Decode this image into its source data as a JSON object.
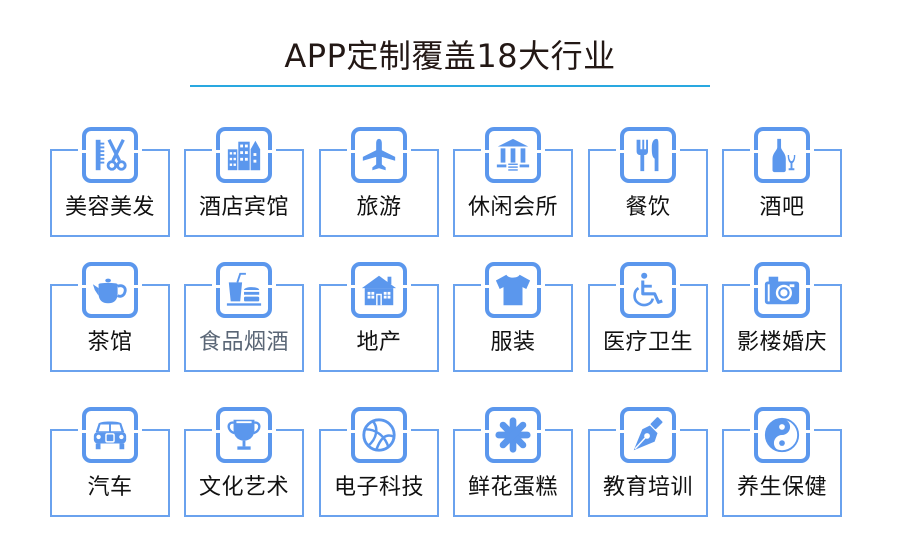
{
  "header": {
    "title": "APP定制覆盖18大行业"
  },
  "colors": {
    "accent": "#5b97ed",
    "frame": "#6aa2ee",
    "rule": "#29a8e0",
    "text": "#111111"
  },
  "industries": [
    {
      "label": "美容美发",
      "icon": "scissors-comb-icon"
    },
    {
      "label": "酒店宾馆",
      "icon": "buildings-icon"
    },
    {
      "label": "旅游",
      "icon": "airplane-icon"
    },
    {
      "label": "休闲会所",
      "icon": "columns-building-icon"
    },
    {
      "label": "餐饮",
      "icon": "fork-knife-icon"
    },
    {
      "label": "酒吧",
      "icon": "wine-bottle-glass-icon"
    },
    {
      "label": "茶馆",
      "icon": "teapot-icon"
    },
    {
      "label": "食品烟酒",
      "icon": "drink-burger-icon"
    },
    {
      "label": "地产",
      "icon": "house-icon"
    },
    {
      "label": "服装",
      "icon": "tshirt-icon"
    },
    {
      "label": "医疗卫生",
      "icon": "wheelchair-icon"
    },
    {
      "label": "影楼婚庆",
      "icon": "camera-icon"
    },
    {
      "label": "汽车",
      "icon": "car-icon"
    },
    {
      "label": "文化艺术",
      "icon": "trophy-icon"
    },
    {
      "label": "电子科技",
      "icon": "basketball-icon"
    },
    {
      "label": "鲜花蛋糕",
      "icon": "asterisk-flower-icon"
    },
    {
      "label": "教育培训",
      "icon": "pen-nib-icon"
    },
    {
      "label": "养生保健",
      "icon": "yin-yang-icon"
    }
  ]
}
